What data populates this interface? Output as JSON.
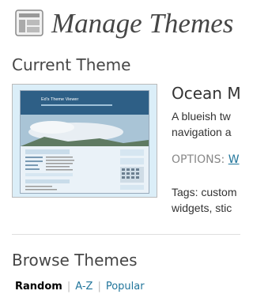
{
  "page": {
    "title": "Manage Themes"
  },
  "current_theme": {
    "heading": "Current Theme",
    "name": "Ocean M",
    "description_lines": [
      "A blueish tw",
      "navigation a"
    ],
    "options_label": "OPTIONS:",
    "options_link": "W",
    "tags_lines": [
      "Tags: custom",
      "widgets, stic"
    ],
    "screenshot": {
      "site_title": "Ed's Theme Viewer"
    }
  },
  "browse": {
    "heading": "Browse Themes",
    "tabs": [
      "Random",
      "A-Z",
      "Popular"
    ],
    "separator": "|"
  }
}
